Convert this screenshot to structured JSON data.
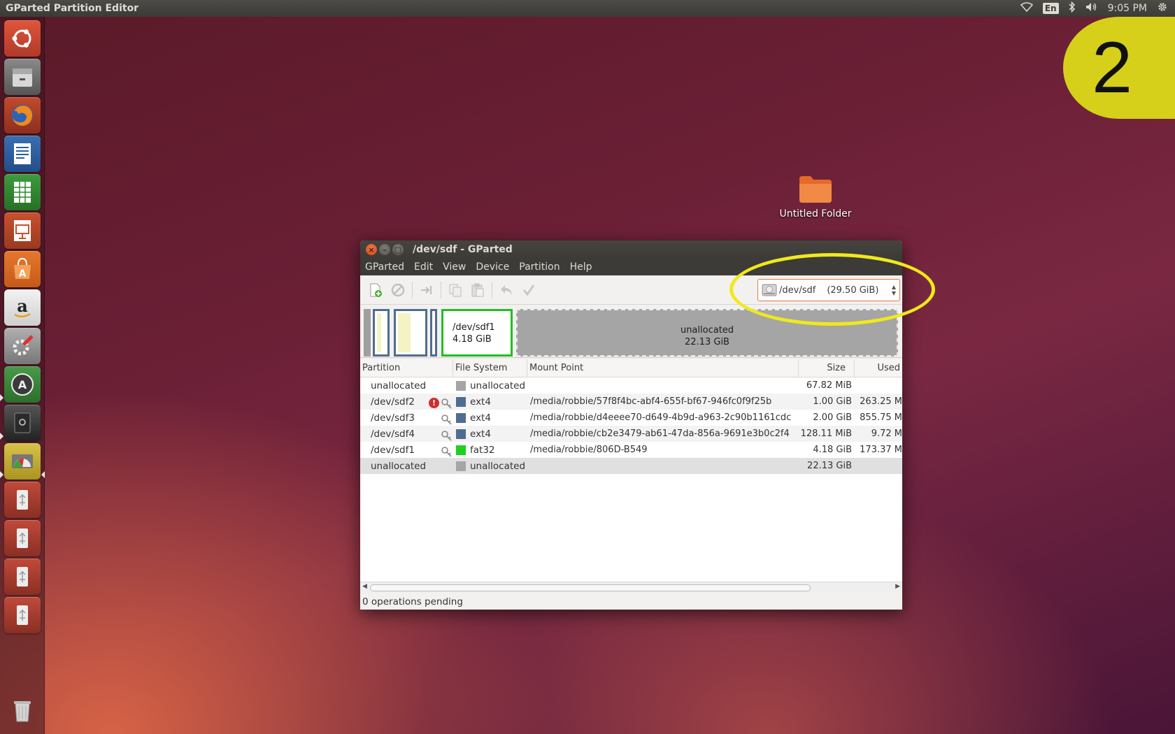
{
  "top_panel": {
    "app_title": "GParted Partition Editor",
    "keyboard_layout": "En",
    "clock": "9:05 PM",
    "icons": [
      "wifi-icon",
      "bluetooth-icon",
      "volume-icon",
      "settings-gear-icon"
    ]
  },
  "launcher": {
    "items": [
      "ubuntu-dash",
      "files",
      "firefox",
      "libreoffice-writer",
      "libreoffice-calc",
      "libreoffice-impress",
      "ubuntu-software-center",
      "amazon",
      "system-settings",
      "software-updater",
      "disk-drive",
      "gparted",
      "usb-drive-1",
      "usb-drive-2",
      "usb-drive-3",
      "usb-drive-4",
      "trash"
    ]
  },
  "desktop": {
    "folder_label": "Untitled Folder"
  },
  "step_badge": "2",
  "window": {
    "title": "/dev/sdf - GParted",
    "menu": [
      "GParted",
      "Edit",
      "View",
      "Device",
      "Partition",
      "Help"
    ],
    "device_selector": {
      "device": "/dev/sdf",
      "size": "(29.50 GiB)"
    },
    "map": {
      "selected_name": "/dev/sdf1",
      "selected_size": "4.18 GiB",
      "unallocated_name": "unallocated",
      "unallocated_size": "22.13 GiB"
    },
    "table": {
      "headers": [
        "Partition",
        "File System",
        "Mount Point",
        "Size",
        "Used"
      ],
      "rows": [
        {
          "partition": "unallocated",
          "fs": "unallocated",
          "fs_color": "#a5a5a5",
          "mount": "",
          "size": "67.82 MiB",
          "used": "",
          "warn": false,
          "key": false
        },
        {
          "partition": "/dev/sdf2",
          "fs": "ext4",
          "fs_color": "#4f6d8f",
          "mount": "/media/robbie/57f8f4bc-abf4-655f-bf67-946fc0f9f25b",
          "size": "1.00 GiB",
          "used": "263.25 M",
          "warn": true,
          "key": true
        },
        {
          "partition": "/dev/sdf3",
          "fs": "ext4",
          "fs_color": "#4f6d8f",
          "mount": "/media/robbie/d4eeee70-d649-4b9d-a963-2c90b1161cdc",
          "size": "2.00 GiB",
          "used": "855.75 M",
          "warn": false,
          "key": true
        },
        {
          "partition": "/dev/sdf4",
          "fs": "ext4",
          "fs_color": "#4f6d8f",
          "mount": "/media/robbie/cb2e3479-ab61-47da-856a-9691e3b0c2f4",
          "size": "128.11 MiB",
          "used": "9.72 M",
          "warn": false,
          "key": true
        },
        {
          "partition": "/dev/sdf1",
          "fs": "fat32",
          "fs_color": "#1fd11f",
          "mount": "/media/robbie/806D-B549",
          "size": "4.18 GiB",
          "used": "173.37 M",
          "warn": false,
          "key": true
        },
        {
          "partition": "unallocated",
          "fs": "unallocated",
          "fs_color": "#a5a5a5",
          "mount": "",
          "size": "22.13 GiB",
          "used": "",
          "warn": false,
          "key": false
        }
      ]
    },
    "status": "0 operations pending"
  },
  "colors": {
    "highlight": "#f0e81c",
    "badge": "#d6d01a",
    "ubuntu_orange": "#dd4814"
  }
}
